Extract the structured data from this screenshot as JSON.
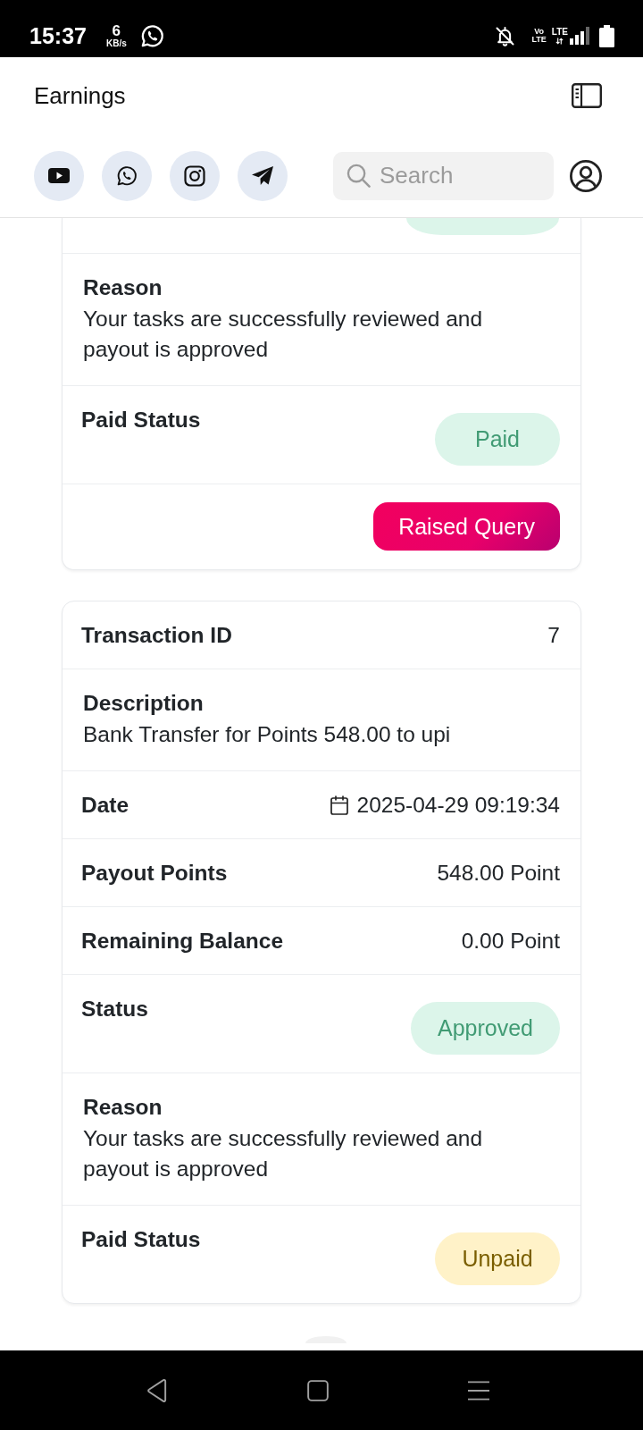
{
  "status_bar": {
    "time": "15:37",
    "speed_value": "6",
    "speed_unit": "KB/s",
    "volte": [
      "Vo",
      "LTE"
    ],
    "network": "LTE"
  },
  "header": {
    "title": "Earnings"
  },
  "search": {
    "placeholder": "Search"
  },
  "cards": [
    {
      "cut_top": true,
      "rows": [
        {
          "kind": "badge_stub",
          "color": "#dcf5ea"
        },
        {
          "kind": "stacked",
          "label": "Reason",
          "value": "Your tasks are successfully reviewed and payout is approved"
        },
        {
          "kind": "badge",
          "label": "Paid Status",
          "value": "Paid",
          "color": "#dcf5ea"
        }
      ],
      "action": {
        "label": "Raised Query"
      }
    },
    {
      "cut_top": false,
      "rows": [
        {
          "kind": "pair",
          "label": "Transaction ID",
          "value": "7"
        },
        {
          "kind": "stacked",
          "label": "Description",
          "value": "Bank Transfer for Points 548.00 to upi"
        },
        {
          "kind": "date",
          "label": "Date",
          "value": "2025-04-29 09:19:34"
        },
        {
          "kind": "pair",
          "label": "Payout Points",
          "value": "548.00 Point"
        },
        {
          "kind": "pair",
          "label": "Remaining Balance",
          "value": "0.00 Point"
        },
        {
          "kind": "badge",
          "label": "Status",
          "value": "Approved",
          "color": "#dcf5ea"
        },
        {
          "kind": "stacked",
          "label": "Reason",
          "value": "Your tasks are successfully reviewed and payout is approved"
        },
        {
          "kind": "badge",
          "label": "Paid Status",
          "value": "Unpaid",
          "color": "#fff2c8"
        }
      ]
    }
  ]
}
